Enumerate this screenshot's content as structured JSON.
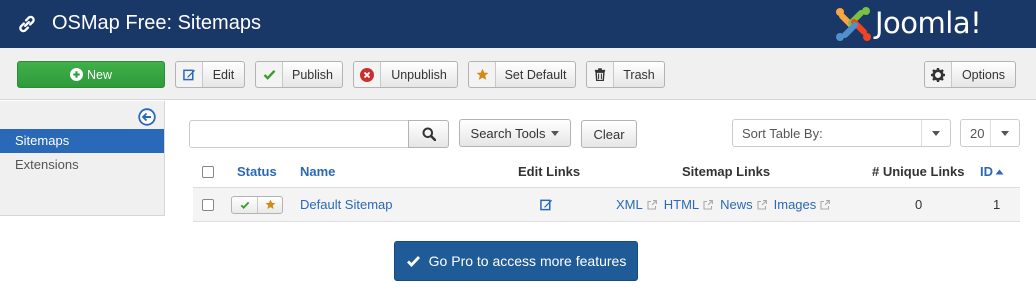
{
  "header": {
    "title": "OSMap Free: Sitemaps",
    "logo_text": "Joomla!",
    "colors": {
      "bar": "#1a3867"
    }
  },
  "toolbar": {
    "new_label": "New",
    "edit_label": "Edit",
    "publish_label": "Publish",
    "unpublish_label": "Unpublish",
    "set_default_label": "Set Default",
    "trash_label": "Trash",
    "options_label": "Options",
    "icons": [
      "plus-circle-icon",
      "edit-icon",
      "check-icon",
      "times-circle-icon",
      "star-icon",
      "trash-icon",
      "gear-icon"
    ]
  },
  "sidebar": {
    "items": [
      {
        "label": "Sitemaps",
        "active": true
      },
      {
        "label": "Extensions",
        "active": false
      }
    ]
  },
  "filters": {
    "search_value": "",
    "search_tools_label": "Search Tools",
    "clear_label": "Clear",
    "sort_label": "Sort Table By:",
    "limit_value": "20"
  },
  "table": {
    "headers": {
      "status": "Status",
      "name": "Name",
      "edit_links": "Edit Links",
      "sitemap_links": "Sitemap Links",
      "unique_links": "# Unique Links",
      "id": "ID"
    },
    "rows": [
      {
        "status_published": true,
        "status_default": true,
        "name": "Default Sitemap",
        "sitemap_links": [
          "XML",
          "HTML",
          "News",
          "Images"
        ],
        "unique_links": "0",
        "id": "1"
      }
    ]
  },
  "gopro": {
    "label": "Go Pro to access more features"
  },
  "colors": {
    "accent": "#2a69b8",
    "success": "#3fb04a",
    "danger": "#c9302c",
    "star": "#d68a16",
    "gopro": "#1f5b96"
  }
}
